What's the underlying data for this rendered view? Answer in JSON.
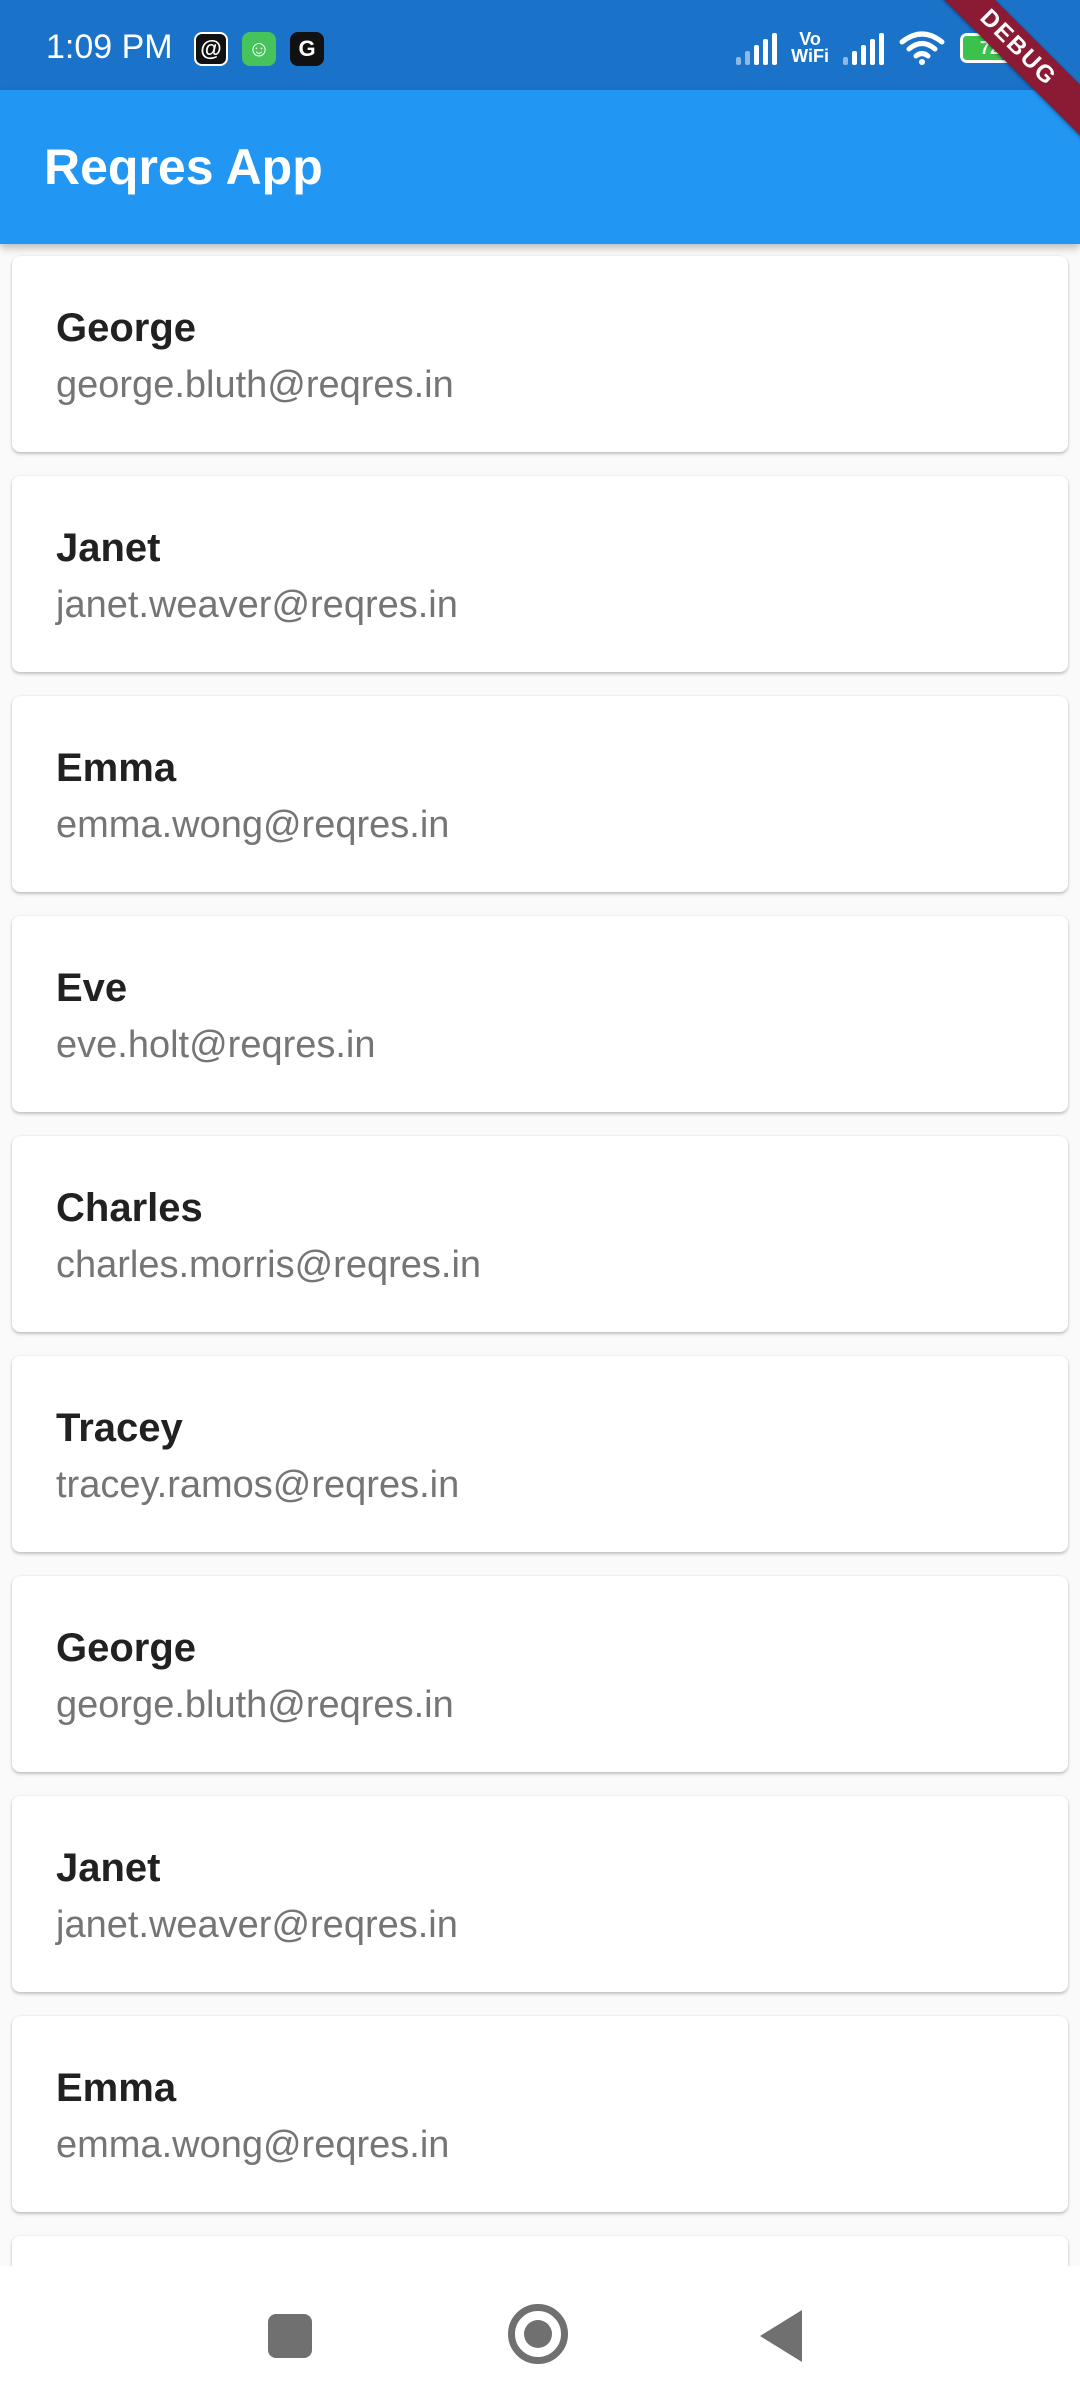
{
  "status_bar": {
    "time": "1:09 PM",
    "vowifi_top": "Vo",
    "vowifi_bottom": "WiFi",
    "battery_level": "72",
    "notification_icons": [
      "threads-icon",
      "bot-icon",
      "google-icon"
    ]
  },
  "debug_banner": "DEBUG",
  "app_bar": {
    "title": "Reqres App"
  },
  "users": [
    {
      "name": "George",
      "email": "george.bluth@reqres.in"
    },
    {
      "name": "Janet",
      "email": "janet.weaver@reqres.in"
    },
    {
      "name": "Emma",
      "email": "emma.wong@reqres.in"
    },
    {
      "name": "Eve",
      "email": "eve.holt@reqres.in"
    },
    {
      "name": "Charles",
      "email": "charles.morris@reqres.in"
    },
    {
      "name": "Tracey",
      "email": "tracey.ramos@reqres.in"
    },
    {
      "name": "George",
      "email": "george.bluth@reqres.in"
    },
    {
      "name": "Janet",
      "email": "janet.weaver@reqres.in"
    },
    {
      "name": "Emma",
      "email": "emma.wong@reqres.in"
    },
    {
      "name": "",
      "email": ""
    }
  ],
  "colors": {
    "status_bar": "#1a73c9",
    "app_bar": "#2196f3",
    "debug_banner": "#8b1b34",
    "battery": "#3bc24b"
  }
}
